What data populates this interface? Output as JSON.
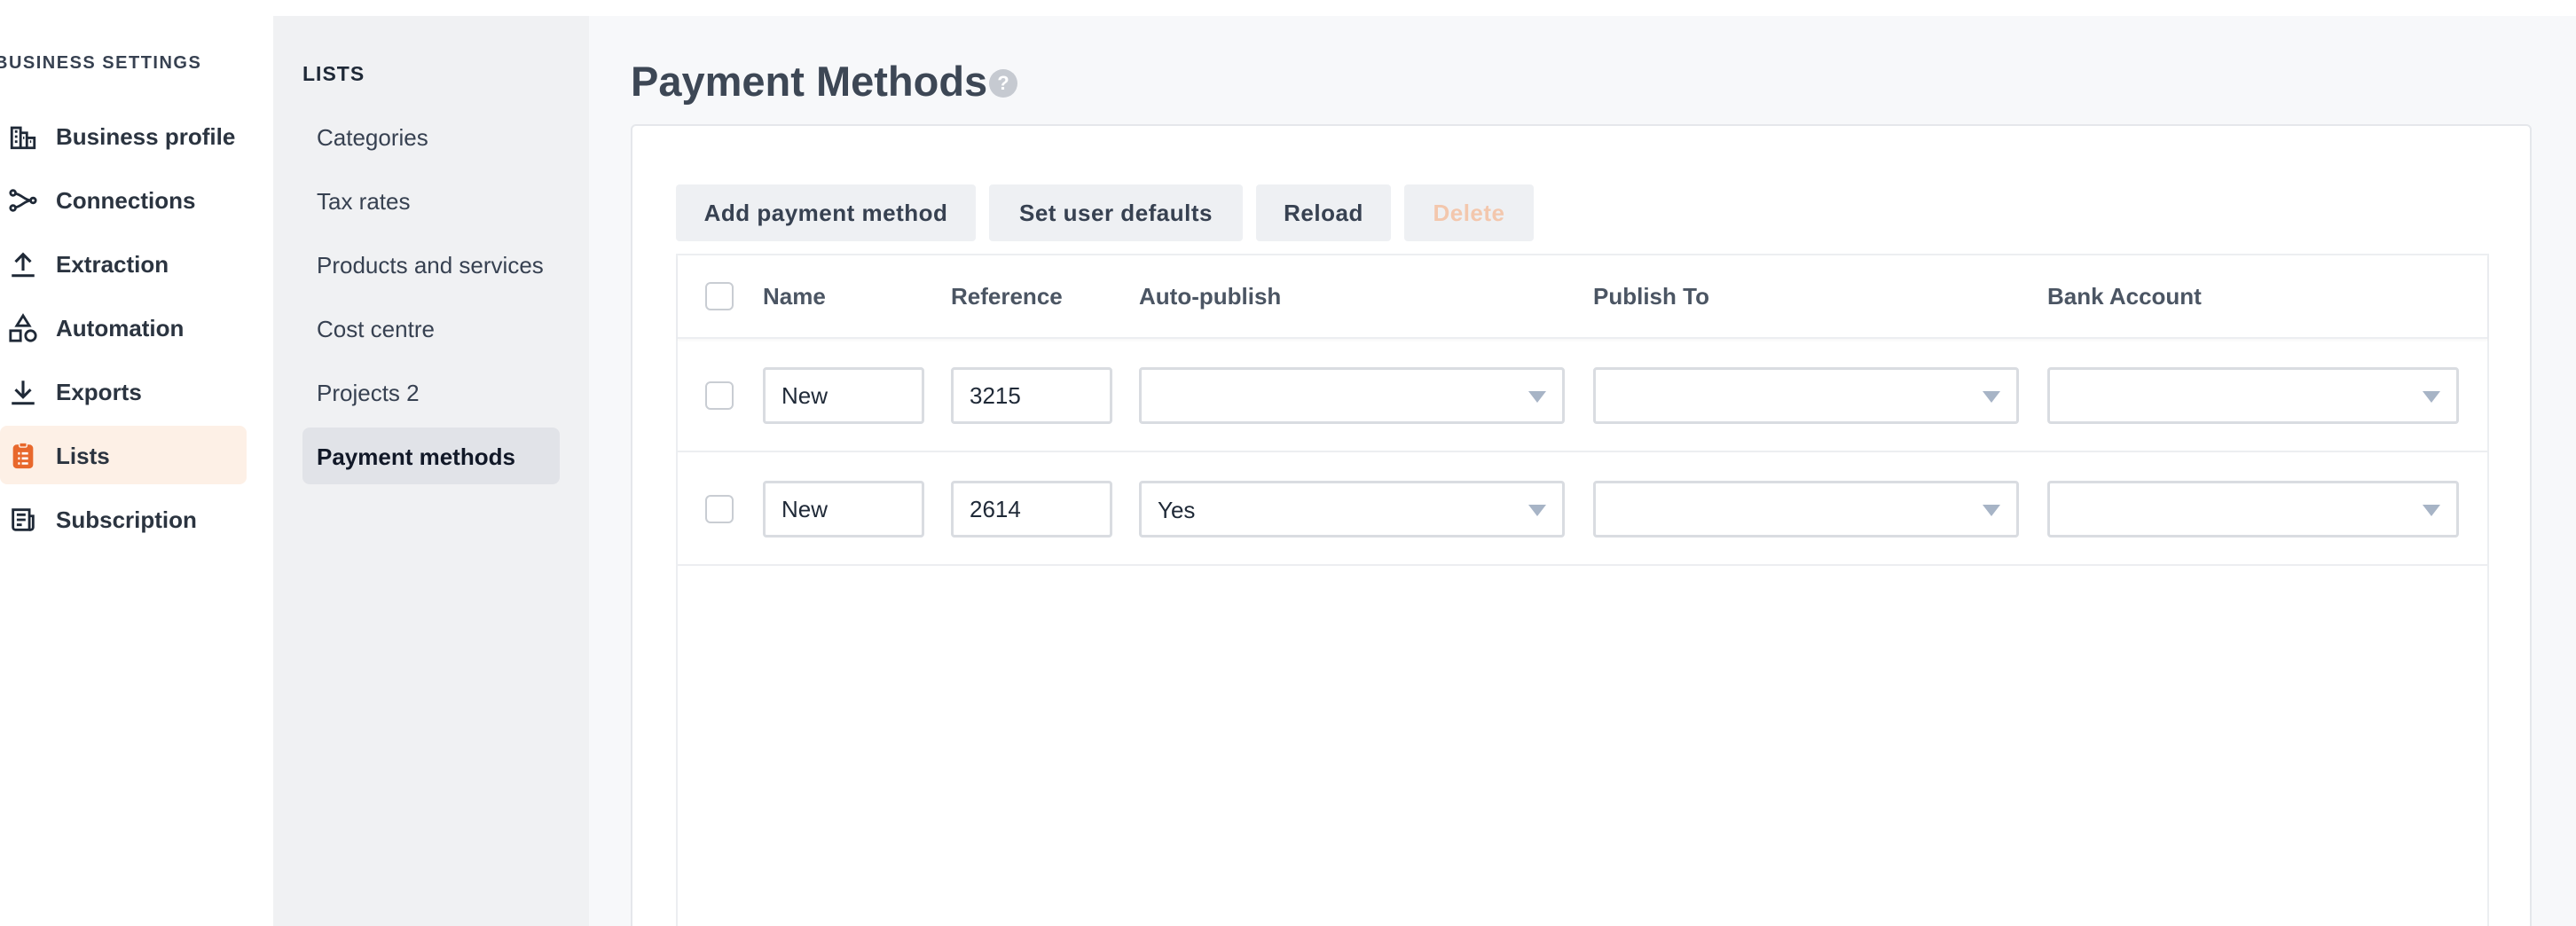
{
  "sidebar": {
    "title": "BUSINESS SETTINGS",
    "items": [
      {
        "label": "Business profile",
        "icon": "building-icon"
      },
      {
        "label": "Connections",
        "icon": "connections-icon"
      },
      {
        "label": "Extraction",
        "icon": "upload-icon"
      },
      {
        "label": "Automation",
        "icon": "shapes-icon"
      },
      {
        "label": "Exports",
        "icon": "download-icon"
      },
      {
        "label": "Lists",
        "icon": "clipboard-list-icon",
        "active": true
      },
      {
        "label": "Subscription",
        "icon": "newspaper-icon"
      }
    ],
    "accent_color": "#e8682c"
  },
  "lists_panel": {
    "title": "LISTS",
    "items": [
      {
        "label": "Categories"
      },
      {
        "label": "Tax rates"
      },
      {
        "label": "Products and services"
      },
      {
        "label": "Cost centre"
      },
      {
        "label": "Projects 2"
      },
      {
        "label": "Payment methods",
        "active": true
      }
    ]
  },
  "main": {
    "title": "Payment Methods",
    "help_icon": "?",
    "toolbar": {
      "add_label": "Add payment method",
      "defaults_label": "Set user defaults",
      "reload_label": "Reload",
      "delete_label": "Delete"
    },
    "table": {
      "columns": [
        "Name",
        "Reference",
        "Auto-publish",
        "Publish To",
        "Bank Account"
      ],
      "rows": [
        {
          "name": "New",
          "reference": "3215",
          "auto_publish": "",
          "publish_to": "",
          "bank_account": ""
        },
        {
          "name": "New",
          "reference": "2614",
          "auto_publish": "Yes",
          "publish_to": "",
          "bank_account": ""
        }
      ]
    }
  }
}
